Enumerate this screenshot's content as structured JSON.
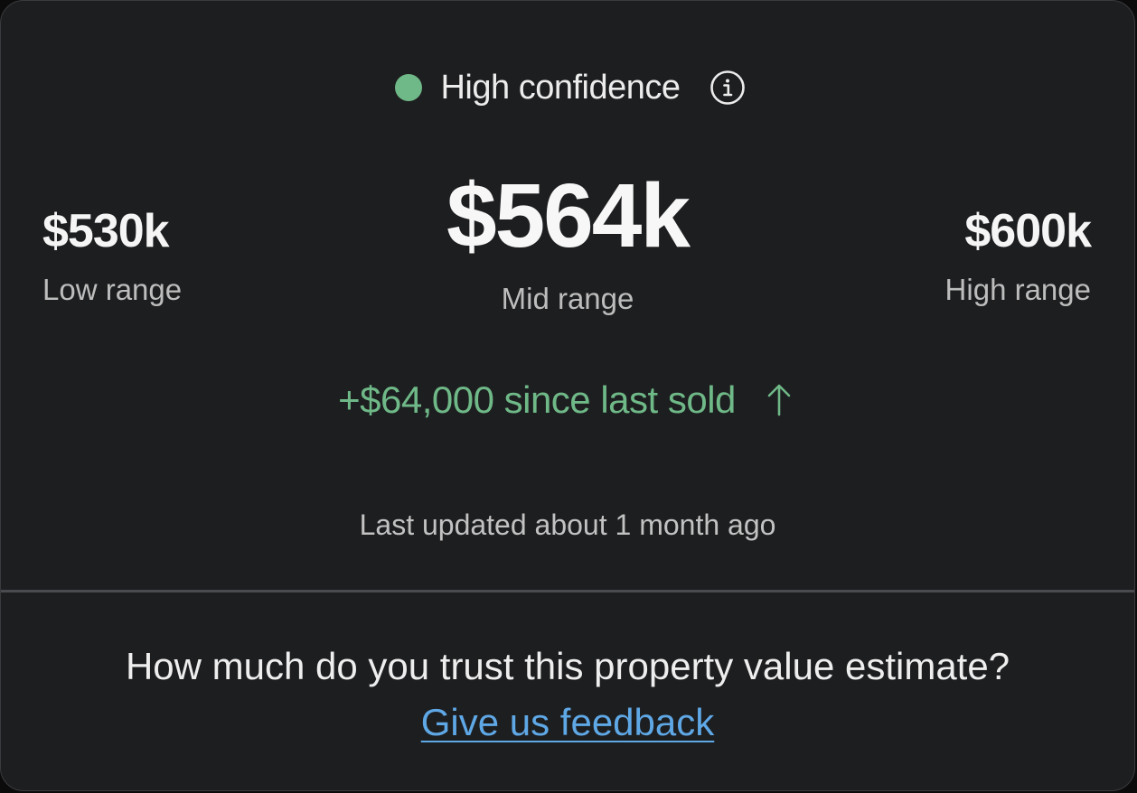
{
  "confidence": {
    "label": "High confidence",
    "dot_color": "#6fb887",
    "info_icon": "info-circle-icon"
  },
  "estimate": {
    "low": {
      "amount": "$530k",
      "label": "Low range"
    },
    "mid": {
      "amount": "$564k",
      "label": "Mid range"
    },
    "high": {
      "amount": "$600k",
      "label": "High range"
    }
  },
  "change": {
    "text": "+$64,000 since last sold",
    "direction_icon": "arrow-up-icon",
    "color": "#6fb887"
  },
  "updated": "Last updated about 1 month ago",
  "feedback": {
    "prompt": "How much do you trust this property value estimate?",
    "link_label": "Give us feedback",
    "link_color": "#5fa8e6"
  }
}
